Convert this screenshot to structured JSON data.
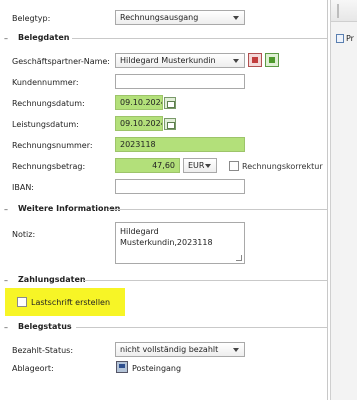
{
  "form": {
    "belegtyp": {
      "label": "Belegtyp:",
      "value": "Rechnungsausgang"
    },
    "sections": {
      "belegdaten": "Belegdaten",
      "weitere": "Weitere Informationen",
      "zahlung": "Zahlungsdaten",
      "status": "Belegstatus"
    },
    "geschaeftspartner": {
      "label": "Geschäftspartner-Name:",
      "value": "Hildegard Musterkundin"
    },
    "kundennummer": {
      "label": "Kundennummer:",
      "value": ""
    },
    "rechnungsdatum": {
      "label": "Rechnungsdatum:",
      "value": "09.10.2024"
    },
    "leistungsdatum": {
      "label": "Leistungsdatum:",
      "value": "09.10.2024"
    },
    "rechnungsnummer": {
      "label": "Rechnungsnummer:",
      "value": "2023118"
    },
    "rechnungsbetrag": {
      "label": "Rechnungsbetrag:",
      "value": "47,60",
      "currency": "EUR",
      "korrektur_label": "Rechnungskorrektur"
    },
    "iban": {
      "label": "IBAN:",
      "value": ""
    },
    "notiz": {
      "label": "Notiz:",
      "value": "Hildegard Musterkundin,2023118"
    },
    "lastschrift": {
      "label": "Lastschrift erstellen",
      "checked": false
    },
    "bezahlt_status": {
      "label": "Bezahlt-Status:",
      "value": "nicht vollständig bezahlt"
    },
    "ablageort": {
      "label": "Ablageort:",
      "value": "Posteingang"
    }
  },
  "side_panel": {
    "item_label": "Pr"
  },
  "colors": {
    "highlight": "#f7f526",
    "field_green": "#b3e07a"
  }
}
